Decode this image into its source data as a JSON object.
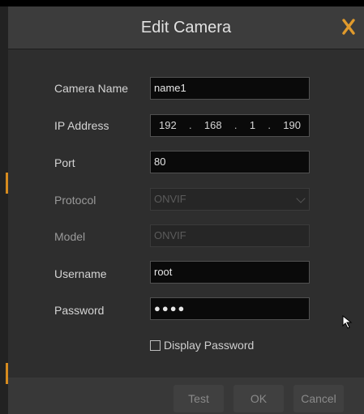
{
  "dialog": {
    "title": "Edit Camera",
    "close_icon": "close-x-icon",
    "accent_color": "#d68b1e"
  },
  "form": {
    "camera_name": {
      "label": "Camera Name",
      "value": "name1"
    },
    "ip_address": {
      "label": "IP Address",
      "octets": [
        "192",
        "168",
        "1",
        "190"
      ],
      "separator": "."
    },
    "port": {
      "label": "Port",
      "value": "80"
    },
    "protocol": {
      "label": "Protocol",
      "value": "ONVIF"
    },
    "model": {
      "label": "Model",
      "value": "ONVIF"
    },
    "username": {
      "label": "Username",
      "value": "root"
    },
    "password": {
      "label": "Password",
      "masked_value": "●●●●"
    },
    "display_password": {
      "label": "Display Password",
      "checked": false
    }
  },
  "buttons": {
    "test": "Test",
    "ok": "OK",
    "cancel": "Cancel"
  }
}
